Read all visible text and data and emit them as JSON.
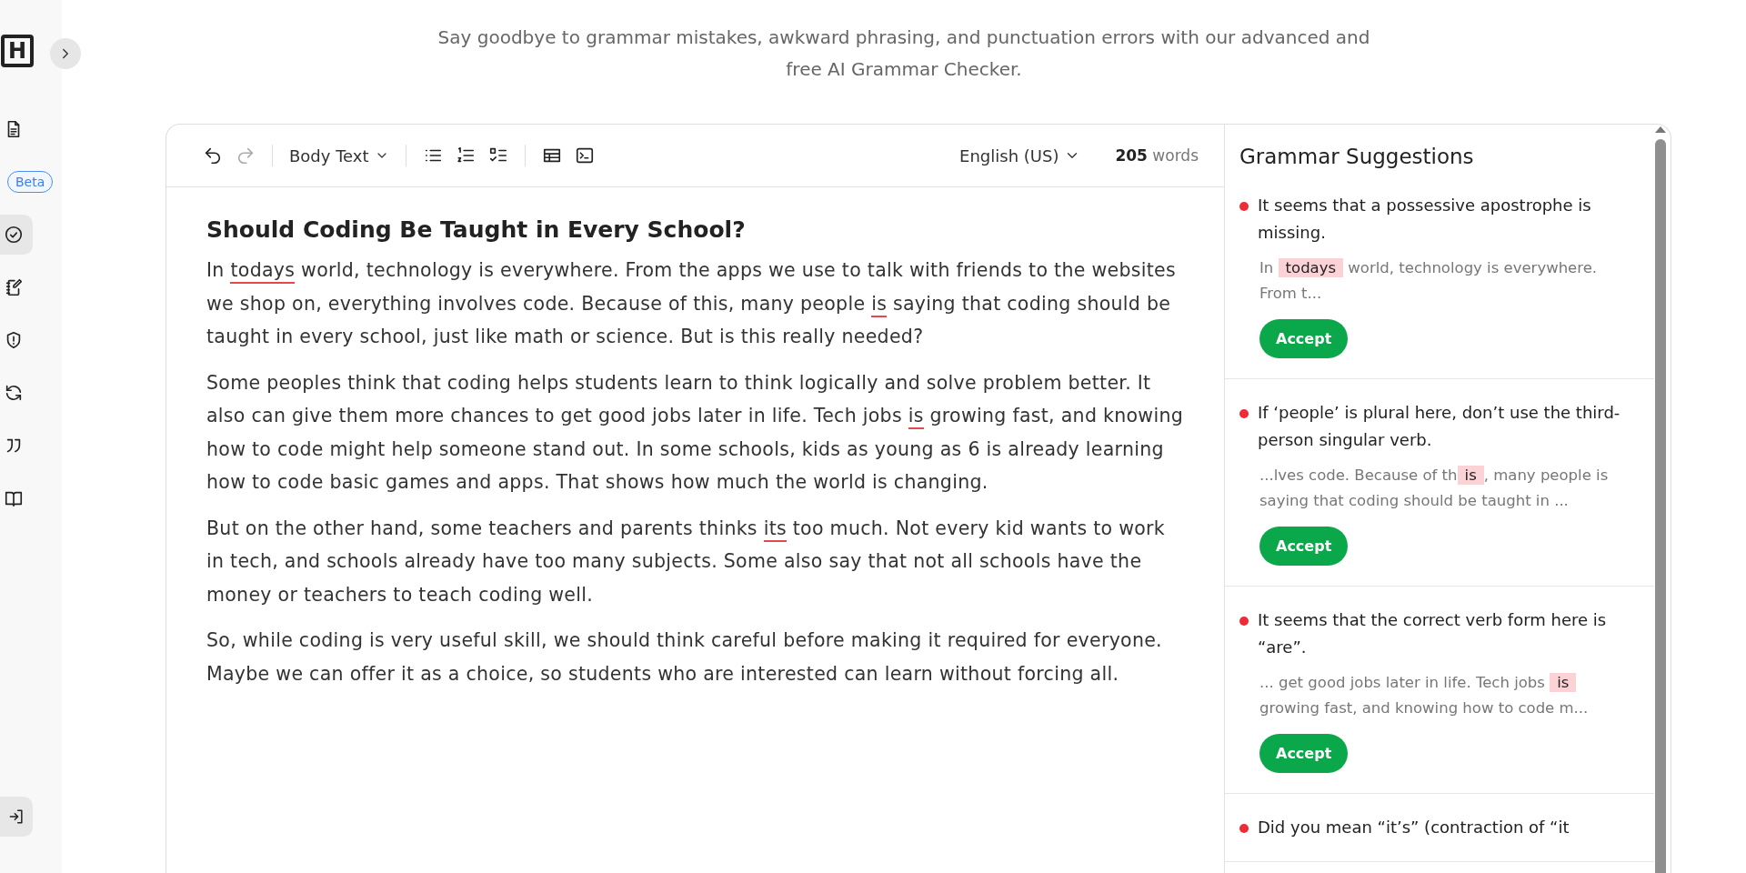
{
  "sidebar": {
    "logo": "H",
    "items": [
      {
        "selected": false
      },
      {
        "badge": "Beta",
        "selected": false
      },
      {
        "selected": true
      },
      {
        "selected": false
      },
      {
        "selected": false
      },
      {
        "selected": false
      },
      {
        "selected": false
      },
      {
        "selected": false
      }
    ]
  },
  "tagline": "Say goodbye to grammar mistakes, awkward phrasing, and punctuation errors with our advanced and free AI Grammar Checker.",
  "toolbar": {
    "undo_disabled": false,
    "redo_disabled": true,
    "style": "Body Text",
    "language": "English (US)",
    "word_count": "**205** words"
  },
  "document": {
    "title": "Should Coding Be Taught in Every School?",
    "paragraphs": [
      [
        {
          "text": "In ",
          "flagged": false
        },
        {
          "text": "todays",
          "flagged": true
        },
        {
          "text": " world, technology is everywhere. From the apps we use to talk with friends to the websites we shop on, everything involves code. Because of this, many people ",
          "flagged": false
        },
        {
          "text": "is",
          "flagged": true
        },
        {
          "text": " saying that coding should be taught in every school, just like math or science. But is this really needed?",
          "flagged": false
        }
      ],
      [
        {
          "text": "Some peoples think that coding helps students learn to think logically and solve problem better. It also can give them more chances to get good jobs later in life. Tech jobs ",
          "flagged": false
        },
        {
          "text": "is",
          "flagged": true
        },
        {
          "text": " growing fast, and knowing how to code might help someone stand out. In some schools, kids as young as 6 is already learning how to code basic games and apps. That shows how much the world is changing.",
          "flagged": false
        }
      ],
      [
        {
          "text": "But on the other hand, some teachers and parents thinks ",
          "flagged": false
        },
        {
          "text": "its",
          "flagged": true
        },
        {
          "text": " too much. Not every kid wants to work in tech, and schools already have too many subjects. Some also say that not all schools have the money or teachers to teach coding well.",
          "flagged": false
        }
      ],
      [
        {
          "text": "So, while coding is very useful skill, we should think careful before making it required for everyone. Maybe we can offer it as a choice, so students who are interested can learn without forcing all.",
          "flagged": false
        }
      ]
    ]
  },
  "suggestions": {
    "title": "Grammar Suggestions",
    "items": [
      {
        "color": "#ee2b36",
        "message": "It seems that a possessive apostrophe is missing.",
        "context_before": "In ",
        "context_highlight": "todays",
        "context_after": " world, technology is everywhere. From t...",
        "button": "Accept"
      },
      {
        "color": "#ee2b36",
        "message": "If ‘people’ is plural here, don’t use the third-person singular verb.",
        "context_before": "...lves code. Because of th",
        "context_highlight": "is",
        "context_after": ", many people is saying that coding should be taught in ...",
        "button": "Accept"
      },
      {
        "color": "#ee2b36",
        "message": "It seems that the correct verb form here is “are”.",
        "context_before": "... get good jobs later in life. Tech jobs ",
        "context_highlight": "is",
        "context_after": " growing fast, and knowing how to code m...",
        "button": "Accept"
      },
      {
        "color": "#ee2b36",
        "message": "Did you mean “it’s” (contraction of “it"
      }
    ]
  }
}
